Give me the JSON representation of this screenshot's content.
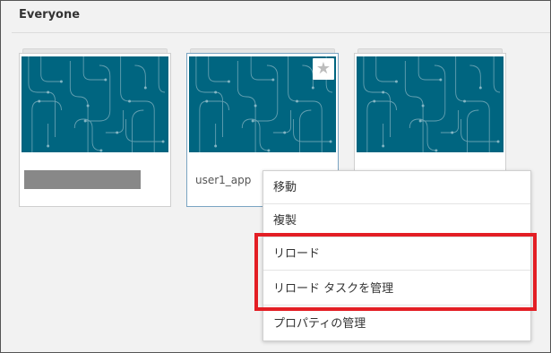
{
  "section": {
    "title": "Everyone"
  },
  "cards": [
    {
      "name": "",
      "redacted": true,
      "starred": false
    },
    {
      "name": "user1_app",
      "redacted": false,
      "starred": true
    },
    {
      "name": "",
      "redacted": false,
      "starred": false
    }
  ],
  "star_glyph": "★",
  "context_menu": {
    "items": [
      {
        "label": "移動"
      },
      {
        "label": "複製"
      },
      {
        "label": "リロード"
      },
      {
        "label": "リロード タスクを管理"
      },
      {
        "label": "プロパティの管理"
      }
    ]
  },
  "colors": {
    "thumbnail": "#006580",
    "highlight": "#e31e24"
  }
}
